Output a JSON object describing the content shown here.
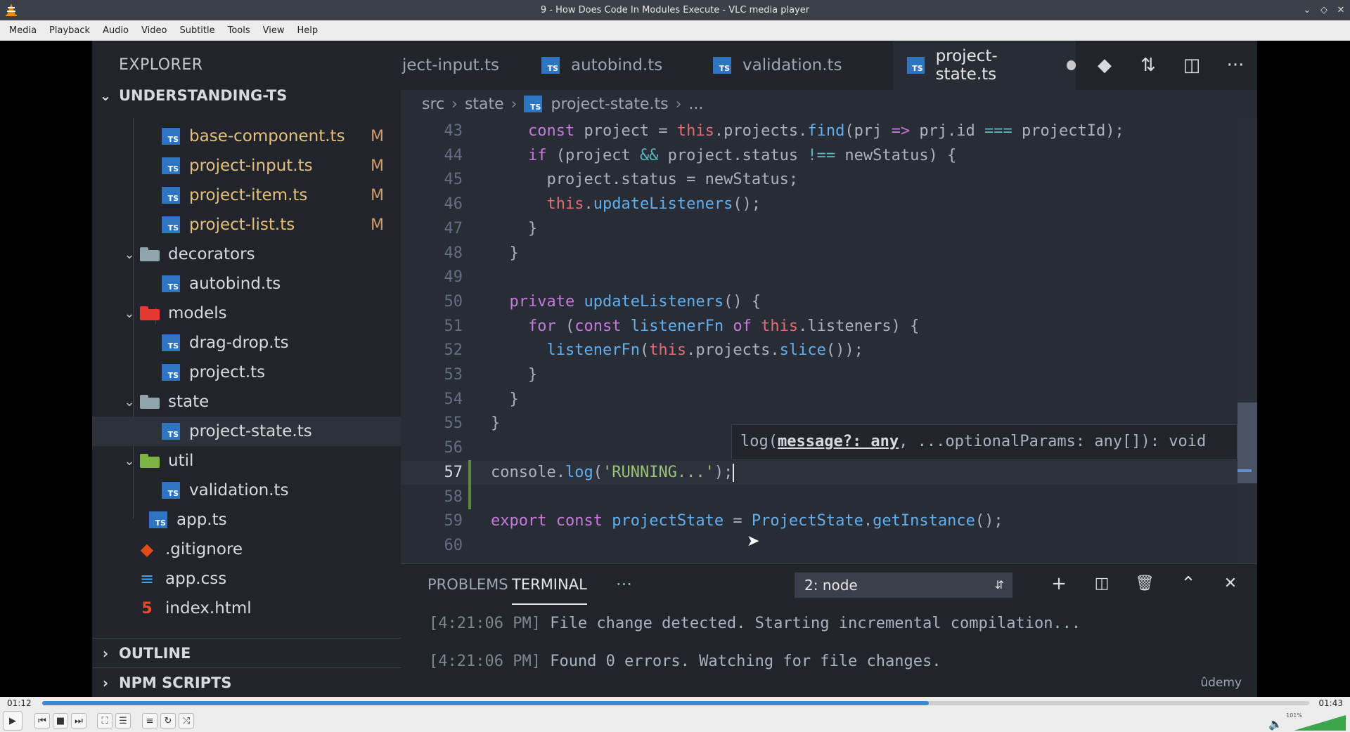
{
  "window": {
    "title": "9 - How Does Code In Modules Execute - VLC media player"
  },
  "menu": [
    "Media",
    "Playback",
    "Audio",
    "Video",
    "Subtitle",
    "Tools",
    "View",
    "Help"
  ],
  "vscode": {
    "explorer_title": "EXPLORER",
    "project_section": "UNDERSTANDING-TS",
    "tree": [
      {
        "name": "base-component.ts",
        "type": "ts",
        "mod": "M"
      },
      {
        "name": "project-input.ts",
        "type": "ts",
        "mod": "M"
      },
      {
        "name": "project-item.ts",
        "type": "ts",
        "mod": "M"
      },
      {
        "name": "project-list.ts",
        "type": "ts",
        "mod": "M"
      },
      {
        "name": "decorators",
        "type": "folder"
      },
      {
        "name": "autobind.ts",
        "type": "ts"
      },
      {
        "name": "models",
        "type": "folder"
      },
      {
        "name": "drag-drop.ts",
        "type": "ts"
      },
      {
        "name": "project.ts",
        "type": "ts"
      },
      {
        "name": "state",
        "type": "folder"
      },
      {
        "name": "project-state.ts",
        "type": "ts",
        "selected": true
      },
      {
        "name": "util",
        "type": "folder"
      },
      {
        "name": "validation.ts",
        "type": "ts"
      },
      {
        "name": "app.ts",
        "type": "ts"
      },
      {
        "name": ".gitignore",
        "type": "git"
      },
      {
        "name": "app.css",
        "type": "css"
      },
      {
        "name": "index.html",
        "type": "html"
      }
    ],
    "outline_section": "OUTLINE",
    "npm_section": "NPM SCRIPTS",
    "tabs": [
      {
        "label": "ject-input.ts"
      },
      {
        "label": "autobind.ts"
      },
      {
        "label": "validation.ts"
      },
      {
        "label": "project-state.ts",
        "active": true
      }
    ],
    "breadcrumb": [
      "src",
      "state",
      "project-state.ts",
      "..."
    ],
    "line_numbers": [
      "43",
      "44",
      "45",
      "46",
      "47",
      "48",
      "49",
      "50",
      "51",
      "52",
      "53",
      "54",
      "55",
      "56",
      "57",
      "58",
      "59",
      "60"
    ],
    "tooltip": {
      "prefix": "log(",
      "param": "message?: any",
      "suffix": ", ...optionalParams: any[]): void"
    },
    "panel": {
      "tab_problems": "PROBLEMS",
      "tab_terminal": "TERMINAL",
      "more": "···",
      "terminal_select": "2: node",
      "lines": [
        {
          "time": "[4:21:06 PM]",
          "text": " File change detected. Starting incremental compilation..."
        },
        {
          "time": "[4:21:06 PM]",
          "text": " Found 0 errors. Watching for file changes."
        }
      ],
      "watermark": "ûdemy"
    }
  },
  "player": {
    "elapsed": "01:12",
    "total": "01:43",
    "progress": 0.7,
    "volume_label": "101%",
    "accent": "#3b88d8"
  },
  "icons": [
    "vlc-cone-icon",
    "minimize-icon",
    "restore-icon",
    "close-icon",
    "play-icon",
    "previous-icon",
    "stop-icon",
    "next-icon",
    "fullscreen-icon",
    "extended-settings-icon",
    "playlist-icon",
    "loop-icon",
    "shuffle-icon",
    "volume-icon"
  ]
}
